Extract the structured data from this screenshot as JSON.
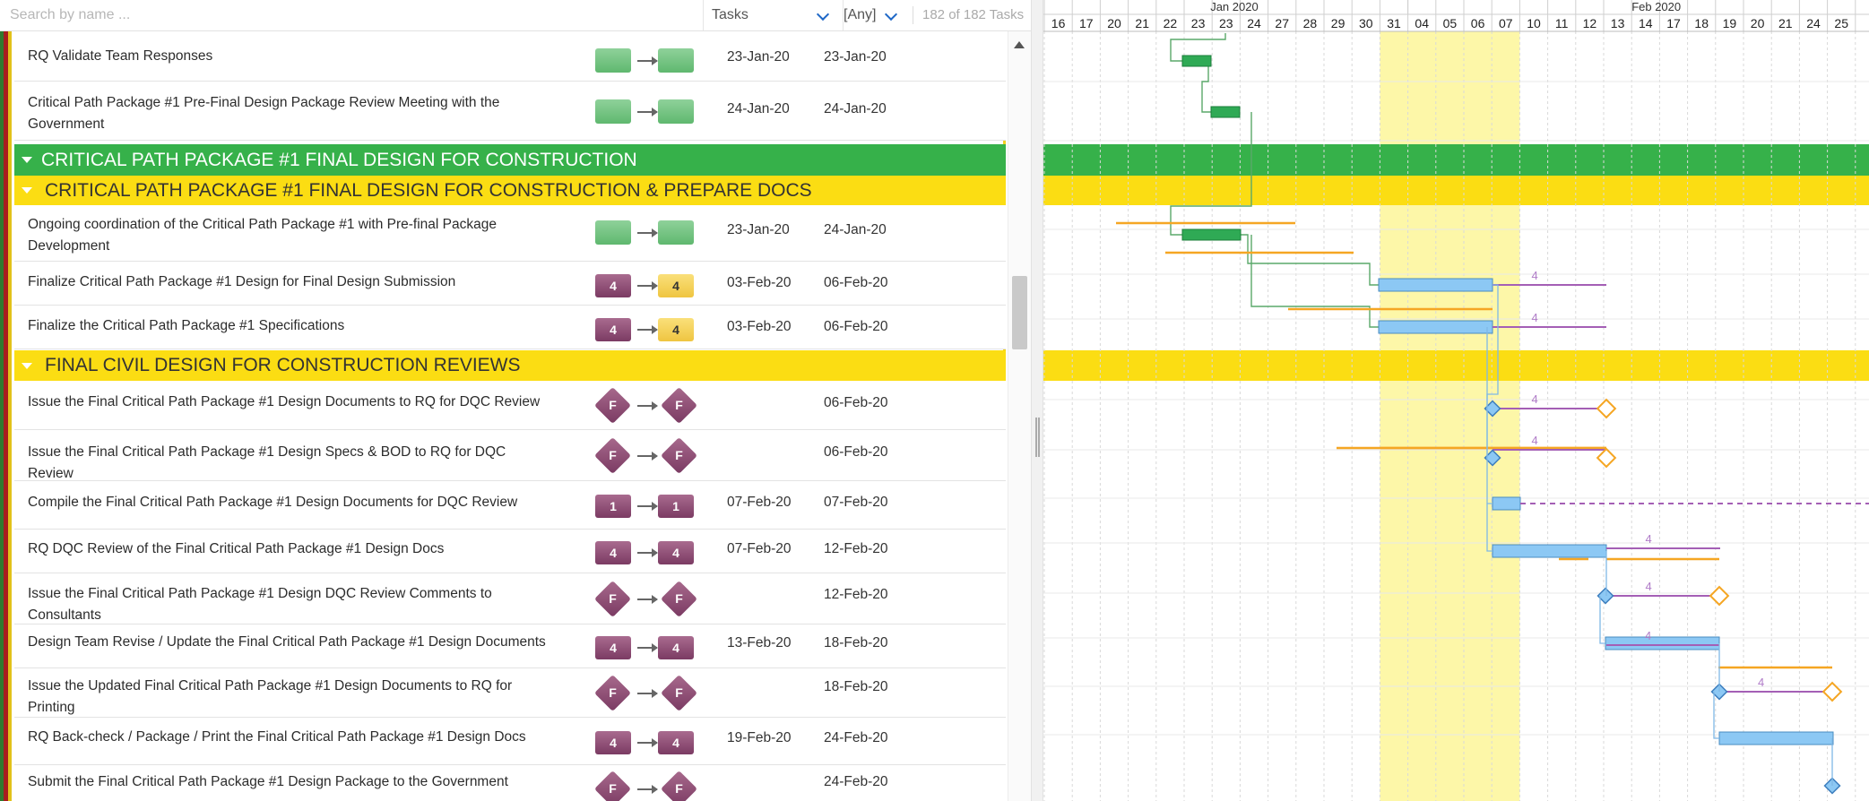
{
  "toolbar": {
    "search_placeholder": "Search by name ...",
    "filter_type": "Tasks",
    "filter_value": "[Any]",
    "count": "182 of 182 Tasks"
  },
  "colors": {
    "green_header": "#36b14a",
    "yellow_header": "#fbdd13",
    "bar_blue": "#8cc8f4",
    "bar_green": "#2faa55",
    "milestone_purple": "#8a4a72",
    "baseline_orange": "#f5a623",
    "today_highlight": "#fdf7a8"
  },
  "timeline": {
    "months": [
      {
        "label": "Jan 2020"
      },
      {
        "label": "Feb 2020"
      }
    ],
    "days": [
      "16",
      "17",
      "20",
      "21",
      "22",
      "23",
      "23",
      "24",
      "27",
      "28",
      "29",
      "30",
      "31",
      "04",
      "05",
      "06",
      "07",
      "10",
      "11",
      "12",
      "13",
      "14",
      "17",
      "18",
      "19",
      "20",
      "21",
      "24",
      "25"
    ]
  },
  "sections": [
    {
      "label": "CRITICAL PATH PACKAGE #1 FINAL DESIGN FOR CONSTRUCTION",
      "color": "green"
    },
    {
      "label": "CRITICAL PATH PACKAGE #1 FINAL DESIGN FOR CONSTRUCTION & PREPARE DOCS",
      "color": "yellow"
    },
    {
      "label": "FINAL CIVIL DESIGN FOR CONSTRUCTION REVIEWS",
      "color": "yellow"
    }
  ],
  "tasks": [
    {
      "name": "RQ Validate Team Responses",
      "from": "",
      "to": "",
      "start": "23-Jan-20",
      "finish": "23-Jan-20"
    },
    {
      "name": "Critical Path Package #1 Pre-Final Design Package Review Meeting with the Government",
      "from": "",
      "to": "",
      "start": "24-Jan-20",
      "finish": "24-Jan-20"
    },
    {
      "name": "Ongoing coordination of the Critical Path Package #1 with Pre-final Package Development",
      "from": "",
      "to": "",
      "start": "23-Jan-20",
      "finish": "24-Jan-20"
    },
    {
      "name": "Finalize Critical Path Package #1 Design for Final Design Submission",
      "from": "4",
      "to": "4",
      "start": "03-Feb-20",
      "finish": "06-Feb-20"
    },
    {
      "name": "Finalize the Critical Path Package #1 Specifications",
      "from": "4",
      "to": "4",
      "start": "03-Feb-20",
      "finish": "06-Feb-20"
    },
    {
      "name": "Issue the Final Critical Path Package #1 Design Documents to RQ for DQC Review",
      "from": "F",
      "to": "F",
      "start": "",
      "finish": "06-Feb-20"
    },
    {
      "name": "Issue the Final Critical Path Package #1 Design Specs & BOD to RQ for DQC Review",
      "from": "F",
      "to": "F",
      "start": "",
      "finish": "06-Feb-20"
    },
    {
      "name": "Compile the Final Critical Path Package #1 Design Documents for DQC Review",
      "from": "1",
      "to": "1",
      "start": "07-Feb-20",
      "finish": "07-Feb-20"
    },
    {
      "name": "RQ DQC Review of the Final Critical Path Package #1 Design Docs",
      "from": "4",
      "to": "4",
      "start": "07-Feb-20",
      "finish": "12-Feb-20"
    },
    {
      "name": "Issue the Final Critical Path Package #1 Design DQC Review Comments to Consultants",
      "from": "F",
      "to": "F",
      "start": "",
      "finish": "12-Feb-20"
    },
    {
      "name": "Design Team Revise / Update the Final Critical Path Package #1 Design Documents",
      "from": "4",
      "to": "4",
      "start": "13-Feb-20",
      "finish": "18-Feb-20"
    },
    {
      "name": "Issue the Updated Final Critical Path Package #1 Design Documents to RQ for Printing",
      "from": "F",
      "to": "F",
      "start": "",
      "finish": "18-Feb-20"
    },
    {
      "name": "RQ Back-check / Package / Print the Final Critical Path Package #1 Design Docs",
      "from": "4",
      "to": "4",
      "start": "19-Feb-20",
      "finish": "24-Feb-20"
    },
    {
      "name": "Submit the Final Critical Path Package #1 Design Package to the Government",
      "from": "F",
      "to": "F",
      "start": "",
      "finish": "24-Feb-20"
    }
  ],
  "gantt": {
    "float_labels": [
      "4",
      "4",
      "4",
      "4",
      "4",
      "4",
      "4",
      "4"
    ]
  }
}
